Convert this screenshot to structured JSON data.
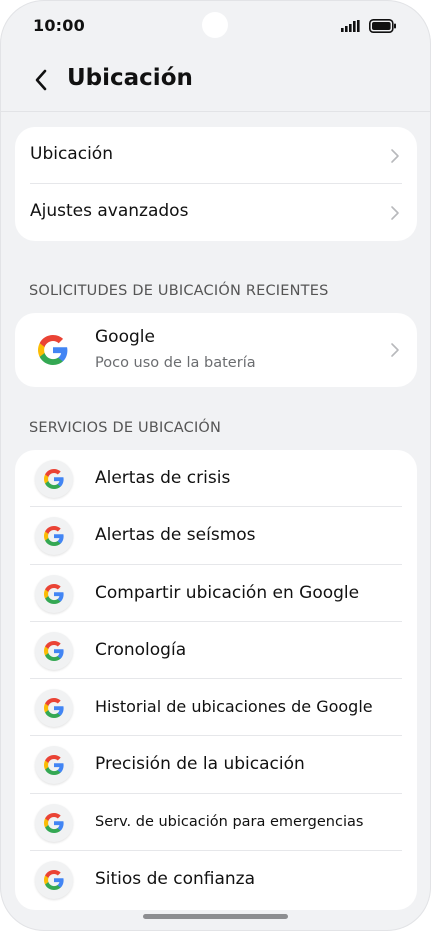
{
  "status_bar": {
    "time": "10:00"
  },
  "header": {
    "title": "Ubicación"
  },
  "main_settings": {
    "items": [
      {
        "label": "Ubicación"
      },
      {
        "label": "Ajustes avanzados"
      }
    ]
  },
  "recent_requests": {
    "section_title": "SOLICITUDES DE UBICACIÓN RECIENTES",
    "items": [
      {
        "title": "Google",
        "subtitle": "Poco uso de la batería",
        "icon": "google-g-icon"
      }
    ]
  },
  "location_services": {
    "section_title": "SERVICIOS DE UBICACIÓN",
    "items": [
      {
        "label": "Alertas de crisis",
        "icon": "google-g-icon"
      },
      {
        "label": "Alertas de seísmos",
        "icon": "google-g-icon"
      },
      {
        "label": "Compartir ubicación en Google",
        "icon": "google-g-icon"
      },
      {
        "label": "Cronología",
        "icon": "google-g-icon"
      },
      {
        "label": "Historial de ubicaciones de Google",
        "icon": "google-g-icon"
      },
      {
        "label": "Precisión de la ubicación",
        "icon": "google-g-icon"
      },
      {
        "label": "Serv. de ubicación para emergencias",
        "icon": "google-g-icon"
      },
      {
        "label": "Sitios de confianza",
        "icon": "google-g-icon"
      }
    ]
  },
  "colors": {
    "background": "#f1f2f4",
    "card": "#ffffff",
    "google_blue": "#4285F4",
    "google_red": "#EA4335",
    "google_yellow": "#FBBC05",
    "google_green": "#34A853"
  }
}
